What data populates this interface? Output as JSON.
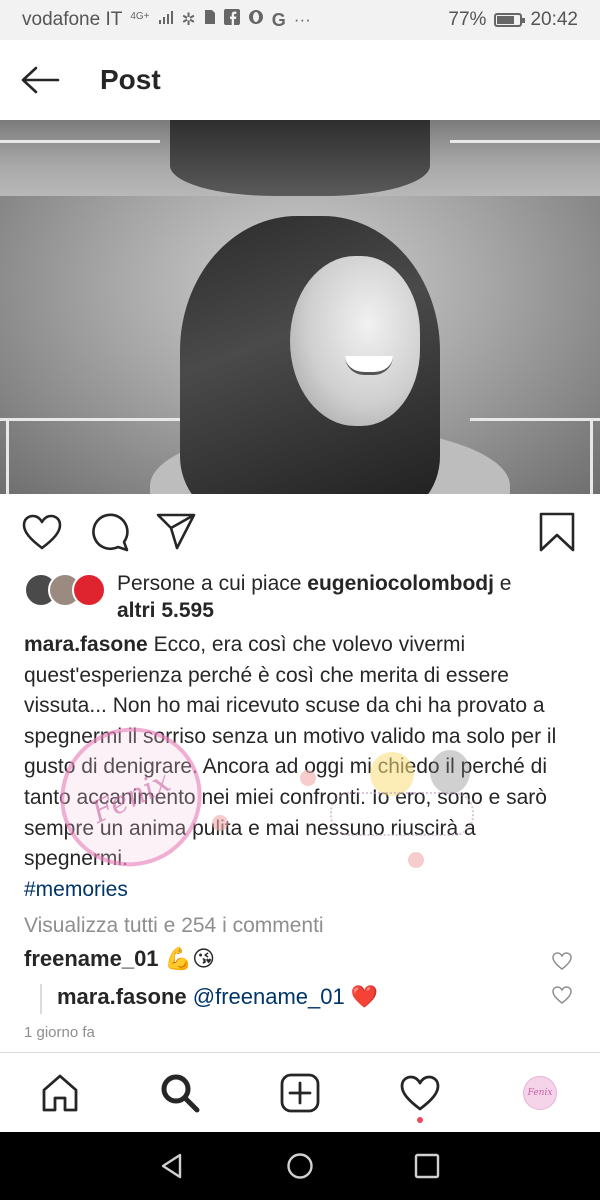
{
  "status_bar": {
    "carrier": "vodafone IT",
    "network": "4G+",
    "battery": "77%",
    "battery_fraction": 0.77,
    "time": "20:42",
    "icons": [
      "signal-icon",
      "snowflake-icon",
      "sim-icon",
      "facebook-icon",
      "opera-icon",
      "google-icon",
      "more-icon",
      "battery-icon"
    ]
  },
  "header": {
    "title": "Post",
    "back_icon": "arrow-left-icon"
  },
  "post": {
    "image_icon": "photo-of-smiling-woman",
    "actions": [
      "heart-icon",
      "comment-icon",
      "share-icon",
      "bookmark-icon"
    ],
    "likes": {
      "prefix": "Persone a cui piace ",
      "user": "eugeniocolombodj",
      "joiner": " e",
      "others": "altri 5.595"
    },
    "caption": {
      "username": "mara.fasone",
      "text": " Ecco, era così che volevo vivermi quest'esperienza perché è così che merita di essere vissuta... Non ho mai ricevuto scuse da chi ha provato a spegnermi il sorriso senza un motivo valido ma solo per il gusto di denigrare. Ancora ad oggi mi chiedo il perché di tanto accanimento nei miei confronti. Io ero, sono e sarò sempre un anima pulita e mai nessuno riuscirà a spegnermi.",
      "hashtag": "#memories"
    },
    "view_comments": "Visualizza tutti e 254 i commenti",
    "comments": [
      {
        "username": "freename_01",
        "emoji": "💪😘"
      }
    ],
    "reply": {
      "username": "mara.fasone",
      "mention": "@freename_01",
      "emoji": "❤️"
    },
    "time": "1 giorno fa"
  },
  "bottom_nav": {
    "items": [
      "home-icon",
      "search-icon",
      "add-post-icon",
      "activity-heart-icon",
      "profile-icon"
    ]
  },
  "system_nav": {
    "items": [
      "back-triangle-icon",
      "home-circle-icon",
      "recents-square-icon"
    ]
  },
  "colors": {
    "link": "#003569",
    "muted": "#8e8e8e",
    "heart_red": "#e0242f",
    "notification": "#ed4956"
  }
}
